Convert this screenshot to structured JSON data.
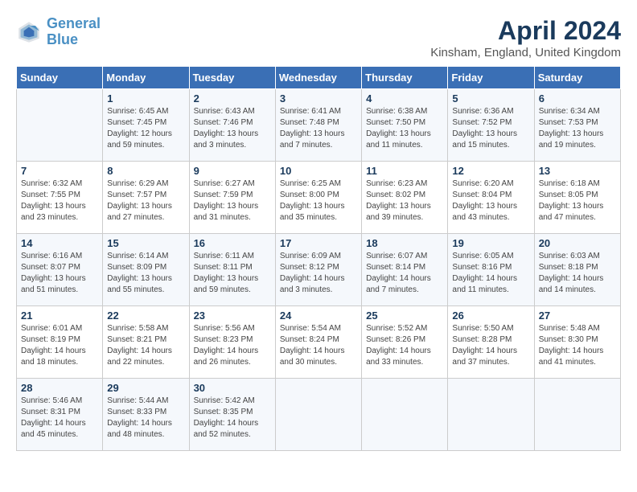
{
  "header": {
    "logo_line1": "General",
    "logo_line2": "Blue",
    "month": "April 2024",
    "location": "Kinsham, England, United Kingdom"
  },
  "weekdays": [
    "Sunday",
    "Monday",
    "Tuesday",
    "Wednesday",
    "Thursday",
    "Friday",
    "Saturday"
  ],
  "weeks": [
    [
      {
        "day": "",
        "info": ""
      },
      {
        "day": "1",
        "info": "Sunrise: 6:45 AM\nSunset: 7:45 PM\nDaylight: 12 hours\nand 59 minutes."
      },
      {
        "day": "2",
        "info": "Sunrise: 6:43 AM\nSunset: 7:46 PM\nDaylight: 13 hours\nand 3 minutes."
      },
      {
        "day": "3",
        "info": "Sunrise: 6:41 AM\nSunset: 7:48 PM\nDaylight: 13 hours\nand 7 minutes."
      },
      {
        "day": "4",
        "info": "Sunrise: 6:38 AM\nSunset: 7:50 PM\nDaylight: 13 hours\nand 11 minutes."
      },
      {
        "day": "5",
        "info": "Sunrise: 6:36 AM\nSunset: 7:52 PM\nDaylight: 13 hours\nand 15 minutes."
      },
      {
        "day": "6",
        "info": "Sunrise: 6:34 AM\nSunset: 7:53 PM\nDaylight: 13 hours\nand 19 minutes."
      }
    ],
    [
      {
        "day": "7",
        "info": "Sunrise: 6:32 AM\nSunset: 7:55 PM\nDaylight: 13 hours\nand 23 minutes."
      },
      {
        "day": "8",
        "info": "Sunrise: 6:29 AM\nSunset: 7:57 PM\nDaylight: 13 hours\nand 27 minutes."
      },
      {
        "day": "9",
        "info": "Sunrise: 6:27 AM\nSunset: 7:59 PM\nDaylight: 13 hours\nand 31 minutes."
      },
      {
        "day": "10",
        "info": "Sunrise: 6:25 AM\nSunset: 8:00 PM\nDaylight: 13 hours\nand 35 minutes."
      },
      {
        "day": "11",
        "info": "Sunrise: 6:23 AM\nSunset: 8:02 PM\nDaylight: 13 hours\nand 39 minutes."
      },
      {
        "day": "12",
        "info": "Sunrise: 6:20 AM\nSunset: 8:04 PM\nDaylight: 13 hours\nand 43 minutes."
      },
      {
        "day": "13",
        "info": "Sunrise: 6:18 AM\nSunset: 8:05 PM\nDaylight: 13 hours\nand 47 minutes."
      }
    ],
    [
      {
        "day": "14",
        "info": "Sunrise: 6:16 AM\nSunset: 8:07 PM\nDaylight: 13 hours\nand 51 minutes."
      },
      {
        "day": "15",
        "info": "Sunrise: 6:14 AM\nSunset: 8:09 PM\nDaylight: 13 hours\nand 55 minutes."
      },
      {
        "day": "16",
        "info": "Sunrise: 6:11 AM\nSunset: 8:11 PM\nDaylight: 13 hours\nand 59 minutes."
      },
      {
        "day": "17",
        "info": "Sunrise: 6:09 AM\nSunset: 8:12 PM\nDaylight: 14 hours\nand 3 minutes."
      },
      {
        "day": "18",
        "info": "Sunrise: 6:07 AM\nSunset: 8:14 PM\nDaylight: 14 hours\nand 7 minutes."
      },
      {
        "day": "19",
        "info": "Sunrise: 6:05 AM\nSunset: 8:16 PM\nDaylight: 14 hours\nand 11 minutes."
      },
      {
        "day": "20",
        "info": "Sunrise: 6:03 AM\nSunset: 8:18 PM\nDaylight: 14 hours\nand 14 minutes."
      }
    ],
    [
      {
        "day": "21",
        "info": "Sunrise: 6:01 AM\nSunset: 8:19 PM\nDaylight: 14 hours\nand 18 minutes."
      },
      {
        "day": "22",
        "info": "Sunrise: 5:58 AM\nSunset: 8:21 PM\nDaylight: 14 hours\nand 22 minutes."
      },
      {
        "day": "23",
        "info": "Sunrise: 5:56 AM\nSunset: 8:23 PM\nDaylight: 14 hours\nand 26 minutes."
      },
      {
        "day": "24",
        "info": "Sunrise: 5:54 AM\nSunset: 8:24 PM\nDaylight: 14 hours\nand 30 minutes."
      },
      {
        "day": "25",
        "info": "Sunrise: 5:52 AM\nSunset: 8:26 PM\nDaylight: 14 hours\nand 33 minutes."
      },
      {
        "day": "26",
        "info": "Sunrise: 5:50 AM\nSunset: 8:28 PM\nDaylight: 14 hours\nand 37 minutes."
      },
      {
        "day": "27",
        "info": "Sunrise: 5:48 AM\nSunset: 8:30 PM\nDaylight: 14 hours\nand 41 minutes."
      }
    ],
    [
      {
        "day": "28",
        "info": "Sunrise: 5:46 AM\nSunset: 8:31 PM\nDaylight: 14 hours\nand 45 minutes."
      },
      {
        "day": "29",
        "info": "Sunrise: 5:44 AM\nSunset: 8:33 PM\nDaylight: 14 hours\nand 48 minutes."
      },
      {
        "day": "30",
        "info": "Sunrise: 5:42 AM\nSunset: 8:35 PM\nDaylight: 14 hours\nand 52 minutes."
      },
      {
        "day": "",
        "info": ""
      },
      {
        "day": "",
        "info": ""
      },
      {
        "day": "",
        "info": ""
      },
      {
        "day": "",
        "info": ""
      }
    ]
  ]
}
